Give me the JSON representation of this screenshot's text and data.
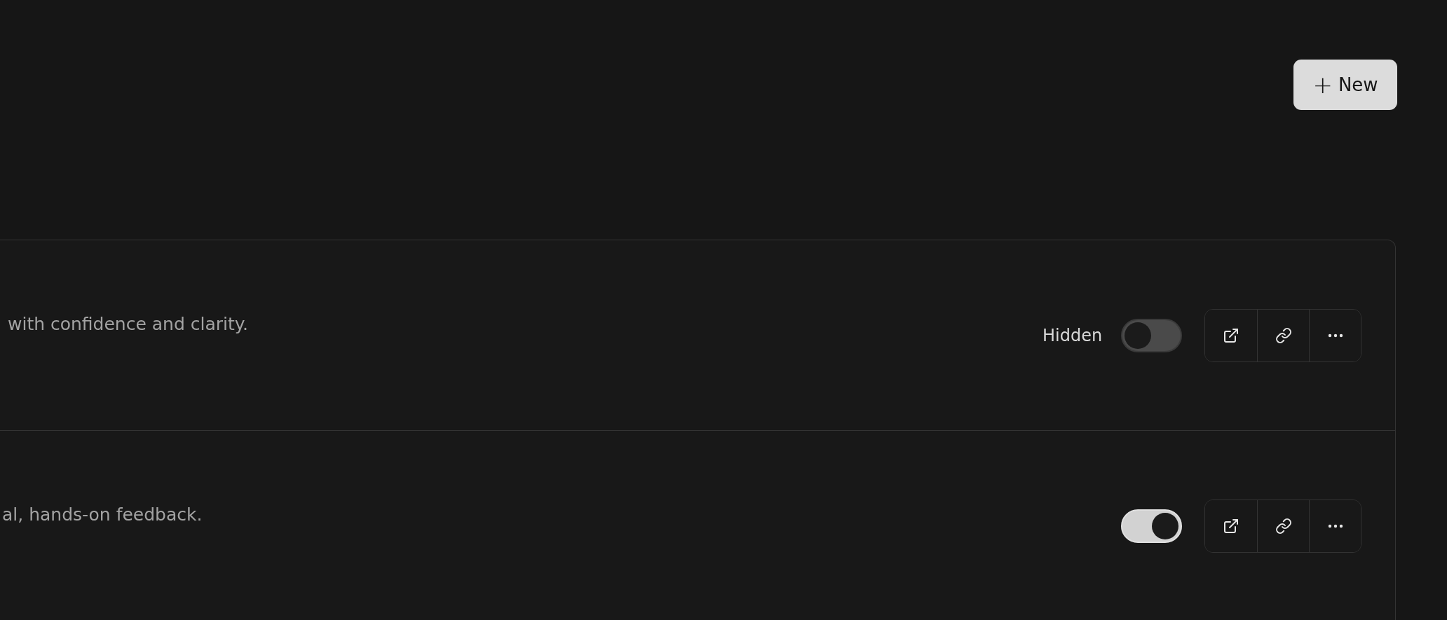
{
  "new_button": {
    "icon": "+",
    "label": "New"
  },
  "rows": [
    {
      "description": "with confidence and clarity.",
      "status_label": "Hidden",
      "on": false
    },
    {
      "description": "al, hands-on feedback.",
      "on": true
    }
  ]
}
